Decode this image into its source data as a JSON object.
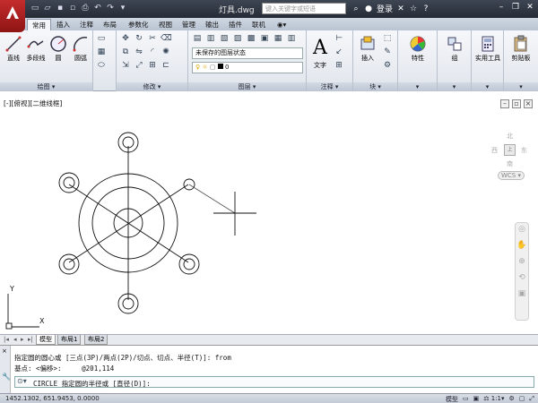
{
  "title_bar": {
    "file_title": "灯具.dwg",
    "search_placeholder": "键入关键字或短语",
    "login_label": "登录"
  },
  "ribbon_tabs": [
    "常用",
    "插入",
    "注释",
    "布局",
    "参数化",
    "视图",
    "管理",
    "输出",
    "插件",
    "联机"
  ],
  "panels": {
    "draw": {
      "title": "绘图",
      "tools": [
        "直线",
        "多段线",
        "圆",
        "圆弧"
      ]
    },
    "modify": {
      "title": "修改"
    },
    "layers": {
      "title": "图层",
      "layer_state": "未保存的图层状态",
      "current_layer": "0"
    },
    "annotation": {
      "title": "注释",
      "text_label": "文字"
    },
    "block": {
      "title": "块",
      "insert_label": "插入"
    },
    "properties": {
      "label": "特性"
    },
    "groups": {
      "label": "组"
    },
    "utilities": {
      "label": "实用工具"
    },
    "clipboard": {
      "label": "剪贴板"
    }
  },
  "viewport": {
    "label": "[-][俯视][二维线框]",
    "viewcube_face": "上",
    "viewcube_directions": {
      "north": "北",
      "south": "南",
      "east": "东",
      "west": "西"
    },
    "wcs_label": "WCS",
    "ucs_x": "X",
    "ucs_y": "Y"
  },
  "layout_tabs": [
    "模型",
    "布局1",
    "布局2"
  ],
  "command": {
    "history_1": "指定圆的圆心或 [三点(3P)/两点(2P)/切点、切点、半径(T)]: from",
    "history_2": "基点: <偏移>:     @201,114",
    "prompt": "CIRCLE 指定圆的半径或 [直径(D)]:"
  },
  "status_bar": {
    "coordinates": "1452.1302, 651.9453, 0.0000",
    "model_label": "模型",
    "scale_label": "1:1"
  },
  "colors": {
    "title_bg": "#2f3540",
    "app_red": "#b42222",
    "ribbon_bg": "#eef1f5"
  }
}
